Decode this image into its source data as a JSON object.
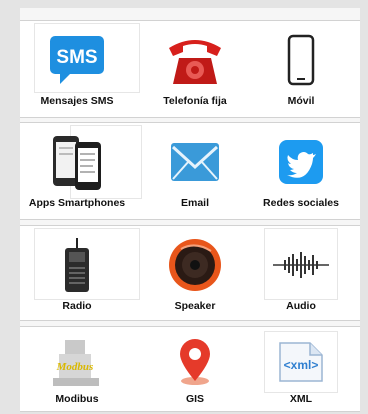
{
  "sections": [
    {
      "items": [
        {
          "label": "Mensajes SMS",
          "icon": "sms-icon"
        },
        {
          "label": "Telefonía fija",
          "icon": "landline-phone-icon"
        },
        {
          "label": "Móvil",
          "icon": "mobile-phone-icon"
        }
      ]
    },
    {
      "items": [
        {
          "label": "Apps Smartphones",
          "icon": "smartphones-icon"
        },
        {
          "label": "Email",
          "icon": "email-icon"
        },
        {
          "label": "Redes sociales",
          "icon": "twitter-bird-icon"
        }
      ]
    },
    {
      "items": [
        {
          "label": "Radio",
          "icon": "radio-icon"
        },
        {
          "label": "Speaker",
          "icon": "speaker-icon"
        },
        {
          "label": "Audio",
          "icon": "audio-waveform-icon"
        }
      ]
    },
    {
      "items": [
        {
          "label": "Modibus",
          "icon": "modbus-icon"
        },
        {
          "label": "GIS",
          "icon": "map-pin-icon"
        },
        {
          "label": "XML",
          "icon": "xml-icon"
        }
      ]
    }
  ],
  "icon_text": {
    "sms": "SMS",
    "xml": "<xml>",
    "modbus": "Modbus"
  },
  "colors": {
    "sms_blue": "#1e8fe0",
    "phone_red": "#d7201c",
    "email_blue": "#3a9ad9",
    "twitter_blue": "#1d9bf0",
    "speaker_orange": "#e8561b",
    "gis_red": "#e53a2a",
    "xml_blue": "#2f7fd0"
  }
}
